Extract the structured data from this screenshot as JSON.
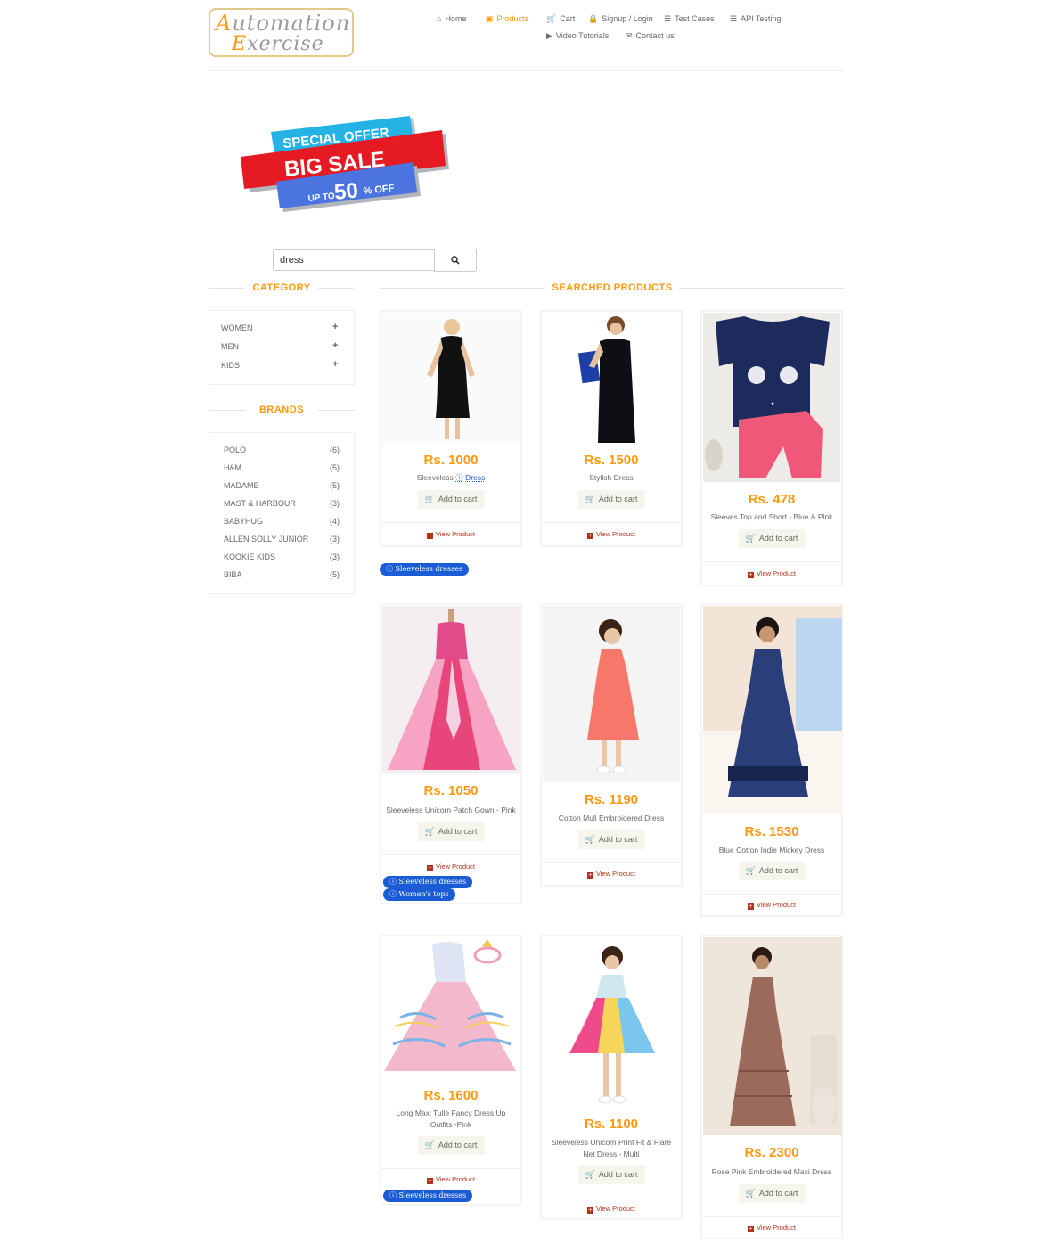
{
  "header": {
    "logo": "Automation Exercise",
    "nav": [
      {
        "label": "Home",
        "icon": "home-icon"
      },
      {
        "label": "Products",
        "icon": "products-icon",
        "active": true
      },
      {
        "label": "Cart",
        "icon": "cart-icon"
      },
      {
        "label": "Signup / Login",
        "icon": "lock-icon"
      },
      {
        "label": "Test Cases",
        "icon": "list-icon"
      },
      {
        "label": "API Testing",
        "icon": "list-icon"
      },
      {
        "label": "Video Tutorials",
        "icon": "youtube-icon"
      },
      {
        "label": "Contact us",
        "icon": "envelope-icon"
      }
    ]
  },
  "banner": {
    "line1": "SPECIAL OFFER",
    "line2": "BIG SALE",
    "line3a": "UP TO",
    "line3b": "50",
    "line3c": "% OFF"
  },
  "search": {
    "value": "dress"
  },
  "sidebar": {
    "category_title": "CATEGORY",
    "categories": [
      "WOMEN",
      "MEN",
      "KIDS"
    ],
    "brands_title": "BRANDS",
    "brands": [
      {
        "name": "POLO",
        "count": "(6)"
      },
      {
        "name": "H&M",
        "count": "(5)"
      },
      {
        "name": "MADAME",
        "count": "(5)"
      },
      {
        "name": "MAST & HARBOUR",
        "count": "(3)"
      },
      {
        "name": "BABYHUG",
        "count": "(4)"
      },
      {
        "name": "ALLEN SOLLY JUNIOR",
        "count": "(3)"
      },
      {
        "name": "KOOKIE KIDS",
        "count": "(3)"
      },
      {
        "name": "BIBA",
        "count": "(5)"
      }
    ]
  },
  "main": {
    "title": "SEARCHED PRODUCTS",
    "add_to_cart": "Add to cart",
    "view_product": "View Product",
    "products": [
      {
        "price": "Rs. 1000",
        "name": "Sleeveless",
        "name_link": "Dress"
      },
      {
        "price": "Rs. 1500",
        "name": "Stylish Dress"
      },
      {
        "price": "Rs. 478",
        "name": "Sleeves Top and Short - Blue & Pink"
      },
      {
        "price": "Rs. 1050",
        "name": "Sleeveless Unicorn Patch Gown - Pink"
      },
      {
        "price": "Rs. 1190",
        "name": "Cotton Mull Embroidered Dress"
      },
      {
        "price": "Rs. 1530",
        "name": "Blue Cotton Indie Mickey Dress"
      },
      {
        "price": "Rs. 1600",
        "name": "Long Maxi Tulle Fancy Dress Up Outfits -Pink"
      },
      {
        "price": "Rs. 1100",
        "name": "Sleeveless Unicorn Print Fit & Flare Net Dress - Multi"
      },
      {
        "price": "Rs. 2300",
        "name": "Rose Pink Embroidered Maxi Dress"
      }
    ],
    "chips": {
      "sleeveless": "Sleeveless dresses",
      "womens_tops": "Women's tops"
    }
  }
}
